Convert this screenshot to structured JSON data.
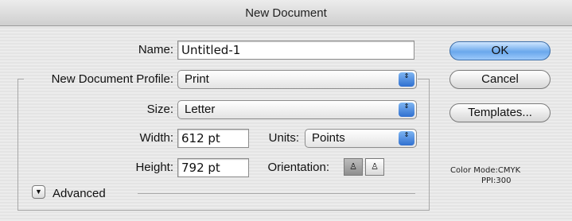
{
  "window": {
    "title": "New Document"
  },
  "form": {
    "name_label": "Name:",
    "name_value": "Untitled-1",
    "profile_label": "New Document Profile:",
    "profile_value": "Print",
    "size_label": "Size:",
    "size_value": "Letter",
    "width_label": "Width:",
    "width_value": "612 pt",
    "units_label": "Units:",
    "units_value": "Points",
    "height_label": "Height:",
    "height_value": "792 pt",
    "orientation_label": "Orientation:",
    "advanced_label": "Advanced"
  },
  "buttons": {
    "ok": "OK",
    "cancel": "Cancel",
    "templates": "Templates..."
  },
  "info": {
    "color_mode": "Color Mode:CMYK",
    "ppi": "PPI:300"
  },
  "icons": {
    "popup_arrows": "⇕",
    "disclosure": "▼",
    "portrait": "♙",
    "landscape": "♙"
  },
  "colors": {
    "accent": "#6aa8ec",
    "popup_arrow": "#2f6fd0"
  }
}
